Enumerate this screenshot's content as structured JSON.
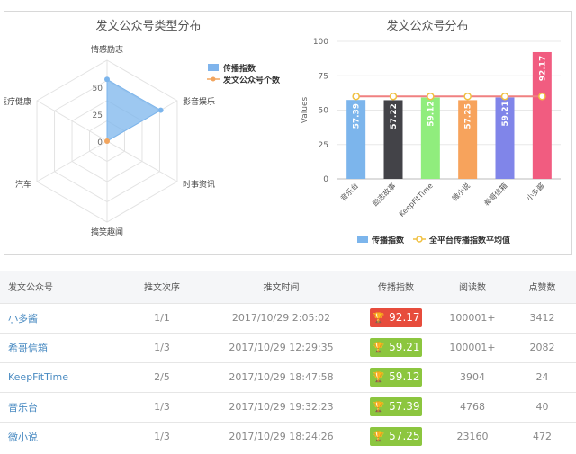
{
  "radar_chart": {
    "title": "发文公众号类型分布",
    "axes": [
      "情感励志",
      "影音娱乐",
      "时事资讯",
      "搞笑趣闻",
      "汽车",
      "医疗健康"
    ],
    "ticks": [
      "0",
      "25",
      "50"
    ],
    "legend": [
      {
        "label": "传播指数",
        "color": "#7fb4ec"
      },
      {
        "label": "发文公众号个数",
        "color": "#f2a55e"
      }
    ]
  },
  "bar_chart": {
    "title": "发文公众号分布",
    "y_axis_label": "Values",
    "legend": [
      {
        "label": "传播指数",
        "color": "#7cb5ec"
      },
      {
        "label": "全平台传播指数平均值",
        "color": "#f0c040"
      }
    ]
  },
  "chart_data": [
    {
      "type": "radar",
      "title": "发文公众号类型分布",
      "axes": [
        "情感励志",
        "影音娱乐",
        "时事资讯",
        "搞笑趣闻",
        "汽车",
        "医疗健康"
      ],
      "rmax": 75,
      "ticks": [
        0,
        25,
        50
      ],
      "series": [
        {
          "name": "传播指数",
          "values": [
            57.25,
            57.39,
            0,
            0,
            0,
            0
          ]
        },
        {
          "name": "发文公众号个数",
          "values": [
            0,
            0,
            0,
            0,
            0,
            0
          ]
        }
      ]
    },
    {
      "type": "bar",
      "title": "发文公众号分布",
      "ylabel": "Values",
      "categories": [
        "音乐台",
        "励志故事",
        "KeepFitTime",
        "微小说",
        "希哥信箱",
        "小多酱"
      ],
      "ylim": [
        0,
        100
      ],
      "yticks": [
        0,
        25,
        50,
        75,
        100
      ],
      "series": [
        {
          "name": "传播指数",
          "values": [
            57.39,
            57.22,
            59.12,
            57.25,
            59.21,
            92.17
          ],
          "colors": [
            "#7cb5ec",
            "#434348",
            "#90ed7d",
            "#f7a35c",
            "#8085e9",
            "#f15c80"
          ]
        },
        {
          "name": "全平台传播指数平均值",
          "values": [
            60,
            60,
            60,
            60,
            60,
            60
          ]
        }
      ]
    }
  ],
  "table": {
    "headers": [
      "发文公众号",
      "推文次序",
      "推文时间",
      "传播指数",
      "阅读数",
      "点赞数"
    ],
    "rows": [
      {
        "name": "小多酱",
        "order": "1/1",
        "time": "2017/10/29 2:05:02",
        "score": "92.17",
        "reads": "100001+",
        "likes": "3412",
        "color": "#e74c3c"
      },
      {
        "name": "希哥信箱",
        "order": "1/3",
        "time": "2017/10/29 12:29:35",
        "score": "59.21",
        "reads": "100001+",
        "likes": "2082",
        "color": "#8cc63f"
      },
      {
        "name": "KeepFitTime",
        "order": "2/5",
        "time": "2017/10/29 18:47:58",
        "score": "59.12",
        "reads": "3904",
        "likes": "24",
        "color": "#8cc63f"
      },
      {
        "name": "音乐台",
        "order": "1/3",
        "time": "2017/10/29 19:32:23",
        "score": "57.39",
        "reads": "4768",
        "likes": "40",
        "color": "#8cc63f"
      },
      {
        "name": "微小说",
        "order": "1/3",
        "time": "2017/10/29 18:24:26",
        "score": "57.25",
        "reads": "23160",
        "likes": "472",
        "color": "#8cc63f"
      }
    ]
  }
}
